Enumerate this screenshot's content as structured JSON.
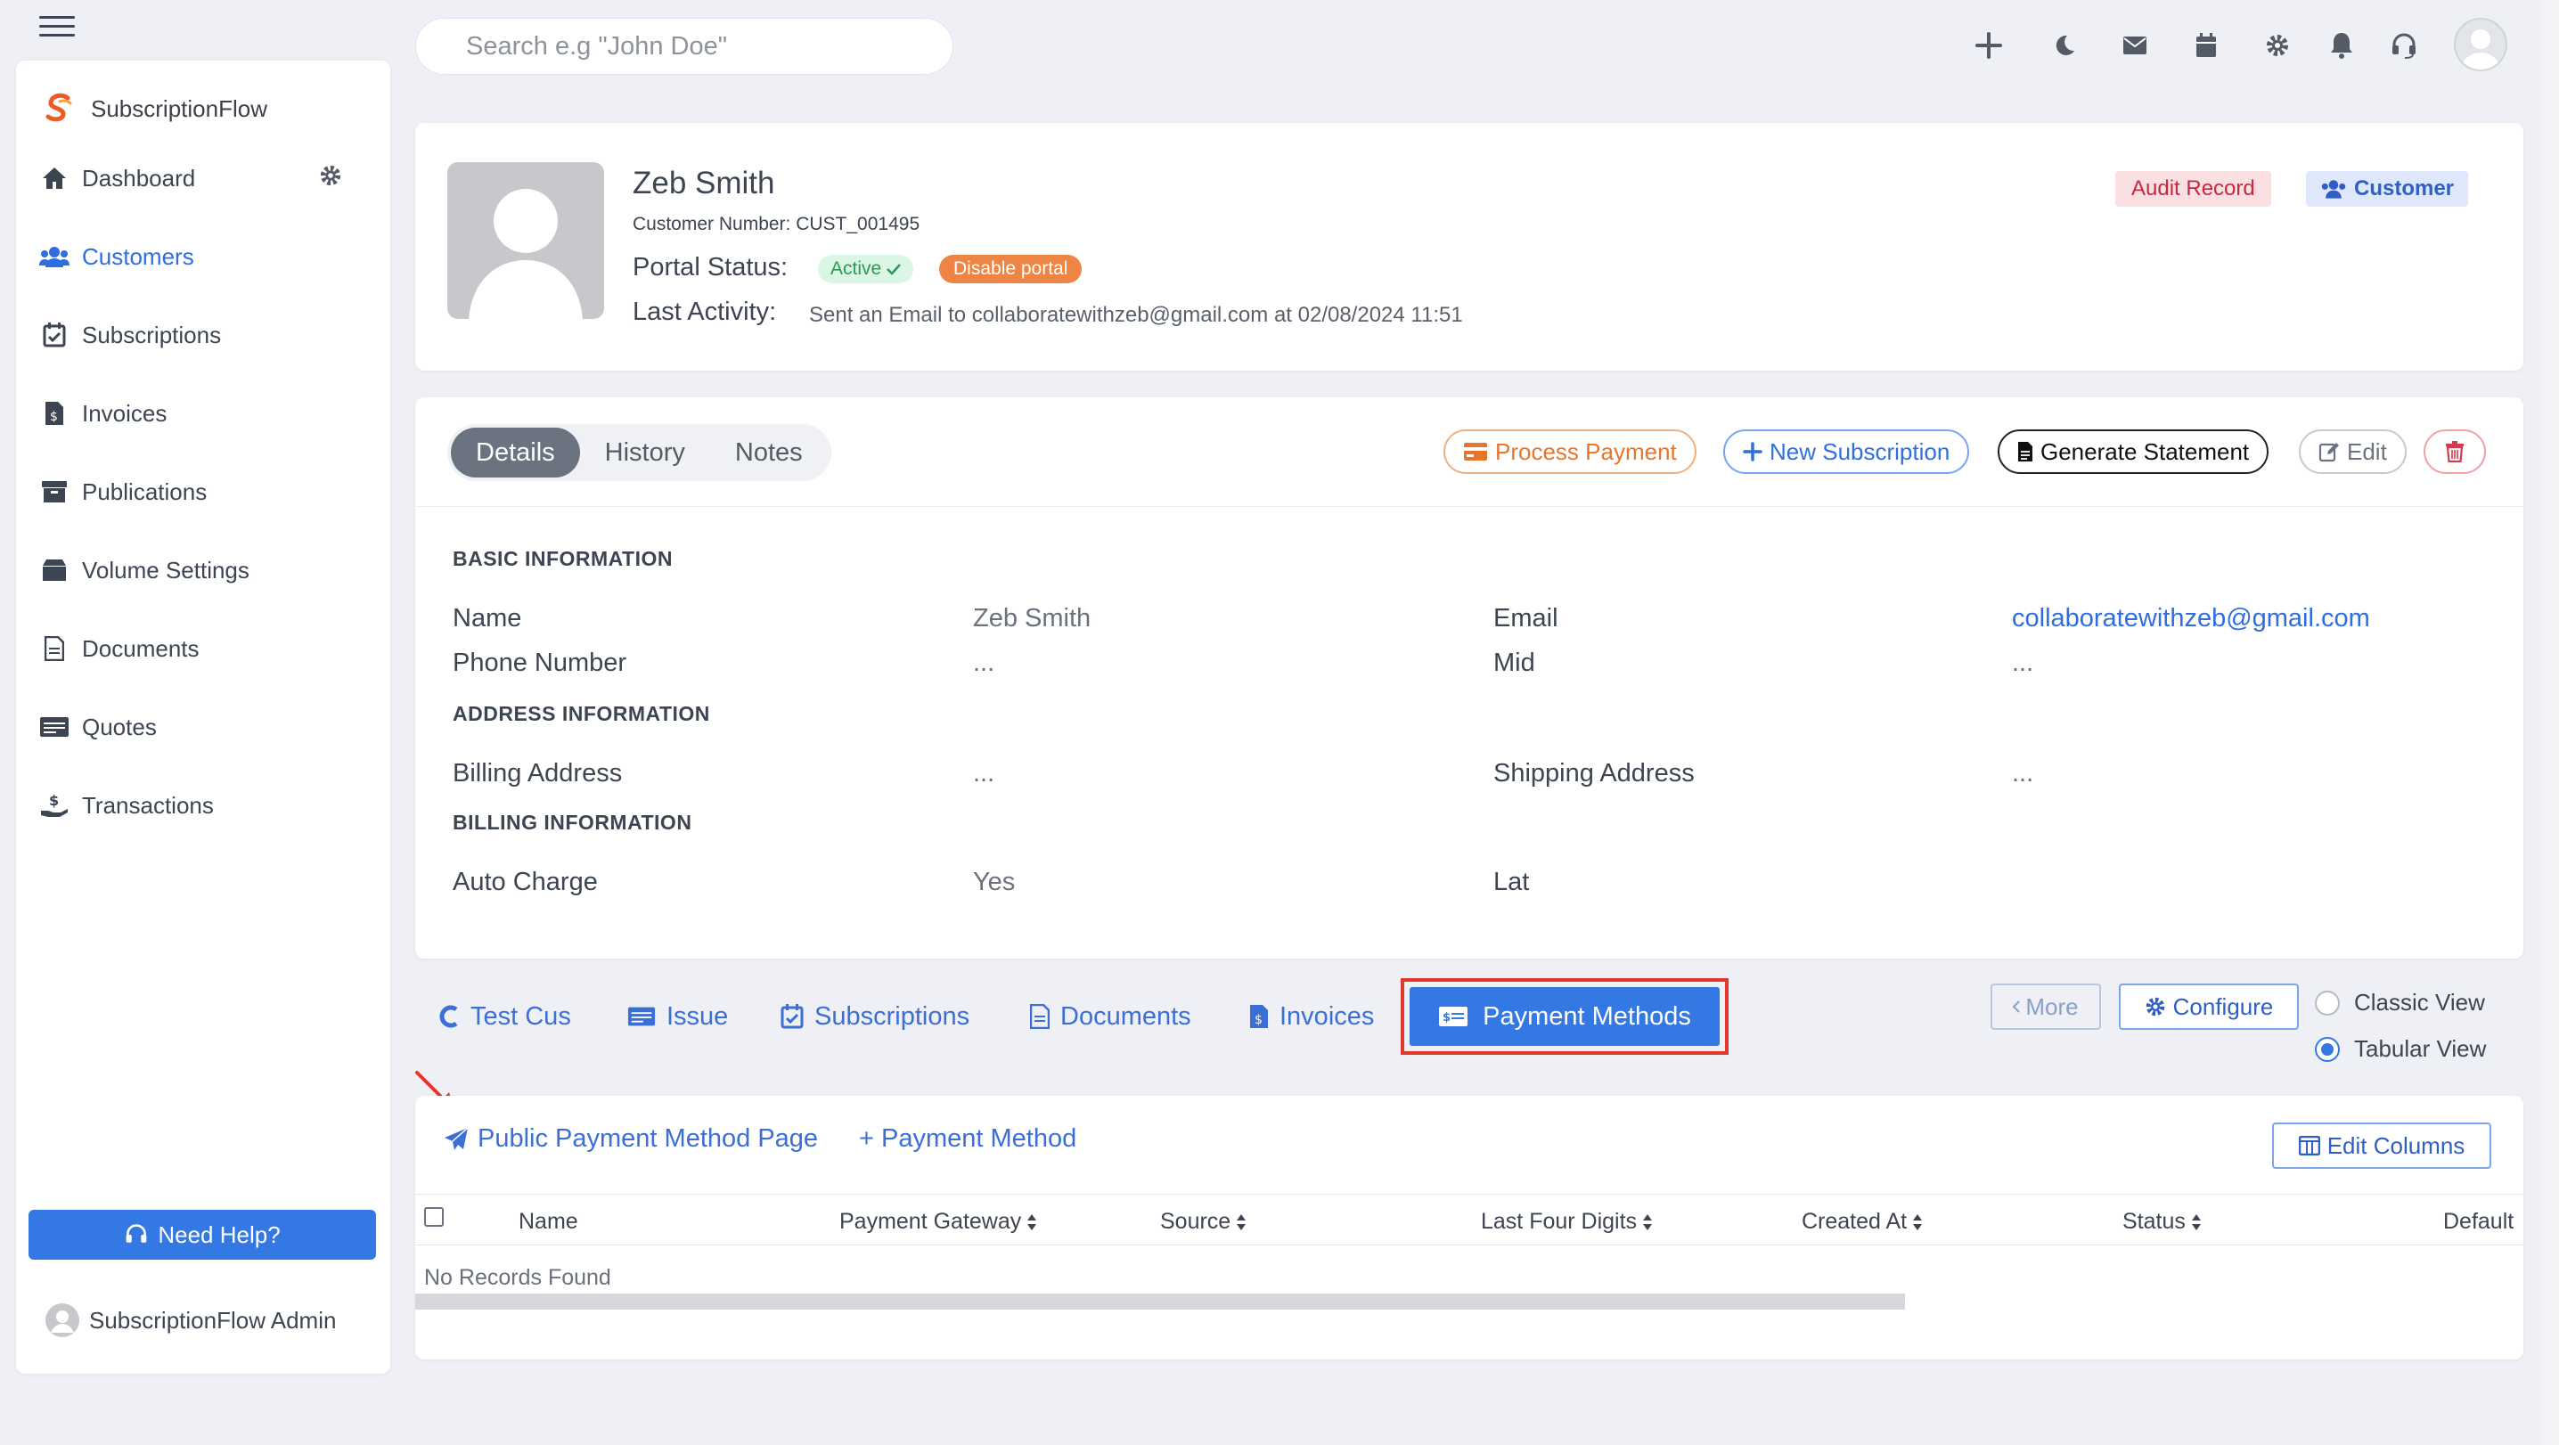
{
  "search": {
    "placeholder": "Search e.g \"John Doe\""
  },
  "brand": {
    "name": "SubscriptionFlow"
  },
  "sidebar": {
    "items": [
      {
        "label": "Dashboard"
      },
      {
        "label": "Customers"
      },
      {
        "label": "Subscriptions"
      },
      {
        "label": "Invoices"
      },
      {
        "label": "Publications"
      },
      {
        "label": "Volume Settings"
      },
      {
        "label": "Documents"
      },
      {
        "label": "Quotes"
      },
      {
        "label": "Transactions"
      }
    ],
    "active": "Customers",
    "help_label": "Need Help?",
    "user_label": "SubscriptionFlow Admin"
  },
  "profile": {
    "name": "Zeb Smith",
    "customer_number": "Customer Number: CUST_001495",
    "portal_label": "Portal Status:",
    "portal_status": "Active",
    "disable_portal": "Disable portal",
    "last_activity_label": "Last Activity:",
    "last_activity": "Sent an Email to collaboratewithzeb@gmail.com at 02/08/2024 11:51",
    "audit_label": "Audit Record",
    "type_badge": "Customer"
  },
  "details": {
    "tabs": [
      "Details",
      "History",
      "Notes"
    ],
    "active_tab": "Details",
    "actions": {
      "process_payment": "Process Payment",
      "new_subscription": "New Subscription",
      "generate_statement": "Generate Statement",
      "edit": "Edit"
    },
    "sections": {
      "basic": "BASIC INFORMATION",
      "address": "ADDRESS INFORMATION",
      "billing": "BILLING INFORMATION"
    },
    "fields": {
      "name_label": "Name",
      "name_value": "Zeb Smith",
      "email_label": "Email",
      "email_value": "collaboratewithzeb@gmail.com",
      "phone_label": "Phone Number",
      "phone_value": "...",
      "mid_label": "Mid",
      "mid_value": "...",
      "billing_label": "Billing Address",
      "billing_value": "...",
      "shipping_label": "Shipping Address",
      "shipping_value": "...",
      "autocharge_label": "Auto Charge",
      "autocharge_value": "Yes",
      "lat_label": "Lat"
    }
  },
  "subtabs": {
    "items": [
      "Test Cus",
      "Issue",
      "Subscriptions",
      "Documents",
      "Invoices",
      "Payment Methods"
    ],
    "active": "Payment Methods",
    "more": "More",
    "configure": "Configure",
    "views": [
      "Classic View",
      "Tabular View"
    ],
    "selected_view": "Tabular View"
  },
  "payment_methods": {
    "public_link": "Public Payment Method Page",
    "add": "+ Payment Method",
    "edit_columns": "Edit Columns",
    "columns": [
      "Name",
      "Payment Gateway",
      "Source",
      "Last Four Digits",
      "Created At",
      "Status",
      "Default"
    ],
    "empty": "No Records Found"
  },
  "colors": {
    "accent": "#3478e4",
    "highlight_box": "#e0392b",
    "annotation_arrow": "#e0392b"
  },
  "icons": [
    "hamburger-icon",
    "plus-icon",
    "moon-icon",
    "mail-icon",
    "calendar-icon",
    "gear-icon",
    "bell-icon",
    "headset-icon",
    "user-avatar-icon"
  ]
}
